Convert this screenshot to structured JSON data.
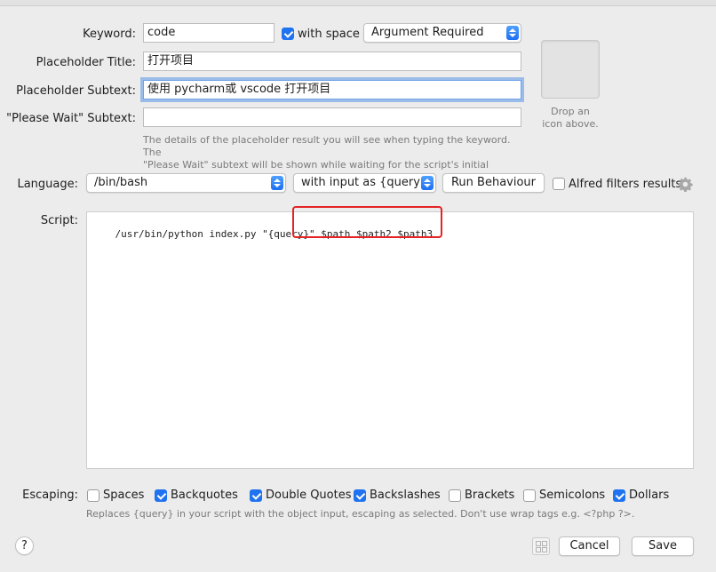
{
  "keyword": {
    "label": "Keyword:",
    "value": "code",
    "with_space_label": "with space",
    "with_space_checked": true,
    "argument_option": "Argument Required"
  },
  "placeholder_title": {
    "label": "Placeholder Title:",
    "value": "打开项目"
  },
  "placeholder_subtext": {
    "label": "Placeholder Subtext:",
    "value": "使用 pycharm或 vscode 打开项目"
  },
  "please_wait_subtext": {
    "label": "\"Please Wait\" Subtext:",
    "value": ""
  },
  "details_hint_line1": "The details of the placeholder result you will see when typing the keyword. The",
  "details_hint_line2": "\"Please Wait\" subtext will be shown while waiting for the script's initial results.",
  "icon_well_hint_line1": "Drop an",
  "icon_well_hint_line2": "icon above.",
  "language": {
    "label": "Language:",
    "value": "/bin/bash",
    "input_mode": "with input as {query}",
    "run_behaviour_label": "Run Behaviour",
    "alfred_filters_label": "Alfred filters results",
    "alfred_filters_checked": false
  },
  "script": {
    "label": "Script:",
    "command": "/usr/bin/python index.py \"{query}\"",
    "highlighted_args": "$path $path2 $path3",
    "highlight_color": "#e32424"
  },
  "escaping": {
    "label": "Escaping:",
    "options": [
      {
        "label": "Spaces",
        "checked": false
      },
      {
        "label": "Backquotes",
        "checked": true
      },
      {
        "label": "Double Quotes",
        "checked": true
      },
      {
        "label": "Backslashes",
        "checked": true
      },
      {
        "label": "Brackets",
        "checked": false
      },
      {
        "label": "Semicolons",
        "checked": false
      },
      {
        "label": "Dollars",
        "checked": true
      }
    ],
    "hint": "Replaces {query} in your script with the object input, escaping as selected. Don't use wrap tags e.g. <?php ?>."
  },
  "footer": {
    "help_label": "?",
    "cancel_label": "Cancel",
    "save_label": "Save"
  },
  "colors": {
    "accent": "#1f73f0",
    "background": "#ececec"
  }
}
